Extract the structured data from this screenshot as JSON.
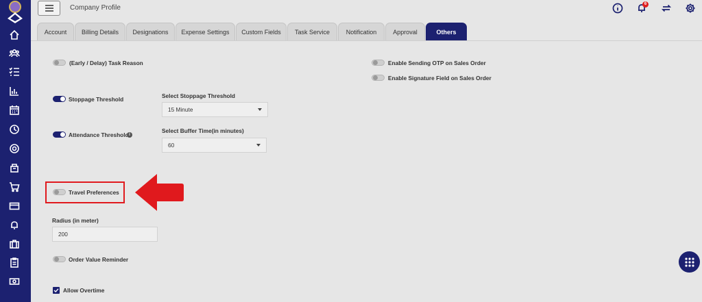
{
  "header": {
    "title": "Company Profile",
    "notification_count": "6"
  },
  "tabs": [
    {
      "label": "Account",
      "active": false
    },
    {
      "label": "Billing Details",
      "active": false
    },
    {
      "label": "Designations",
      "active": false
    },
    {
      "label": "Expense Settings",
      "active": false
    },
    {
      "label": "Custom Fields",
      "active": false
    },
    {
      "label": "Task Service",
      "active": false
    },
    {
      "label": "Notification",
      "active": false
    },
    {
      "label": "Approval",
      "active": false
    },
    {
      "label": "Others",
      "active": true
    }
  ],
  "settings": {
    "early_delay": {
      "label": "(Early / Delay) Task Reason",
      "enabled": false
    },
    "enable_otp": {
      "label": "Enable Sending OTP on Sales Order",
      "enabled": false
    },
    "enable_signature": {
      "label": "Enable Signature Field on Sales Order",
      "enabled": false
    },
    "stoppage": {
      "label": "Stoppage Threshold",
      "enabled": true,
      "select_label": "Select Stoppage Threshold",
      "select_value": "15 Minute"
    },
    "attendance": {
      "label": "Attendance Threshold",
      "enabled": true,
      "select_label": "Select Buffer Time(in minutes)",
      "select_value": "60",
      "info_icon": "i"
    },
    "travel": {
      "label": "Travel Preferences",
      "enabled": false
    },
    "radius": {
      "label": "Radius (in meter)",
      "value": "200"
    },
    "order_value": {
      "label": "Order Value Reminder",
      "enabled": false
    },
    "overtime": {
      "label": "Allow Overtime",
      "checked": true
    }
  },
  "icons": {
    "sidebar": [
      "home-icon",
      "team-icon",
      "task-list-icon",
      "reports-icon",
      "calendar-icon",
      "clock-icon",
      "target-icon",
      "inventory-icon",
      "cart-icon",
      "card-icon",
      "bell-icon",
      "briefcase-icon",
      "clipboard-icon",
      "cash-icon"
    ],
    "header": [
      "info-icon",
      "notification-bell-icon",
      "refresh-icon",
      "settings-gear-icon"
    ]
  },
  "colors": {
    "brand": "#1c2170",
    "highlight": "#e0191d",
    "badge": "#e02020"
  }
}
